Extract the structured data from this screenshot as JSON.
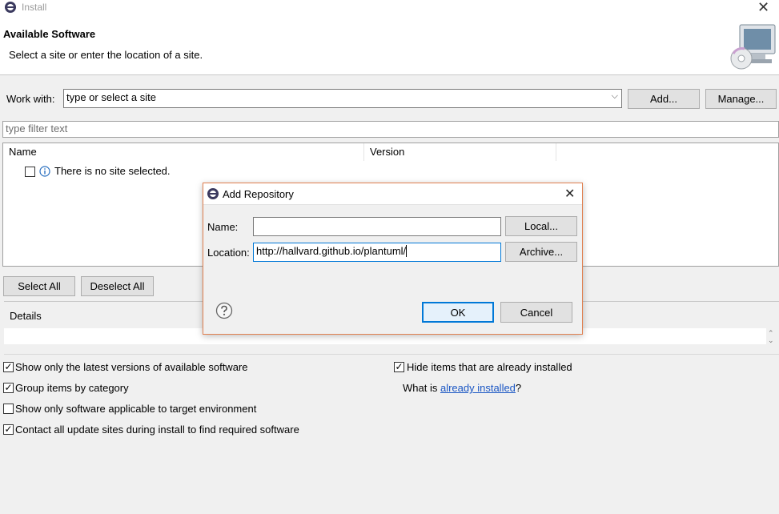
{
  "window": {
    "title": "Install"
  },
  "banner": {
    "title": "Available Software",
    "subtitle": "Select a site or enter the location of a site."
  },
  "work_with": {
    "label": "Work with:",
    "value": "type or select a site",
    "add_label": "Add...",
    "manage_label": "Manage..."
  },
  "filter": {
    "placeholder": "type filter text"
  },
  "table": {
    "columns": [
      "Name",
      "Version"
    ],
    "rows": [
      {
        "name": "There is no site selected.",
        "checked": false
      }
    ]
  },
  "buttons": {
    "select_all": "Select All",
    "deselect_all": "Deselect All"
  },
  "details": {
    "label": "Details"
  },
  "options": {
    "show_latest": {
      "label": "Show only the latest versions of available software",
      "checked": true
    },
    "group_by_category": {
      "label": "Group items by category",
      "checked": true
    },
    "show_applicable": {
      "label": "Show only software applicable to target environment",
      "checked": false
    },
    "contact_all": {
      "label": "Contact all update sites during install to find required software",
      "checked": true
    },
    "hide_installed": {
      "label": "Hide items that are already installed",
      "checked": true
    },
    "what_is_prefix": "What is ",
    "what_is_link": "already installed",
    "what_is_suffix": "?"
  },
  "dialog": {
    "title": "Add Repository",
    "name_label": "Name:",
    "name_value": "",
    "location_label": "Location:",
    "location_value": "http://hallvard.github.io/plantuml/",
    "local_label": "Local...",
    "archive_label": "Archive...",
    "ok_label": "OK",
    "cancel_label": "Cancel"
  },
  "colors": {
    "accent": "#0078d7",
    "link": "#1a56c4",
    "dialog_border": "#e08050"
  }
}
